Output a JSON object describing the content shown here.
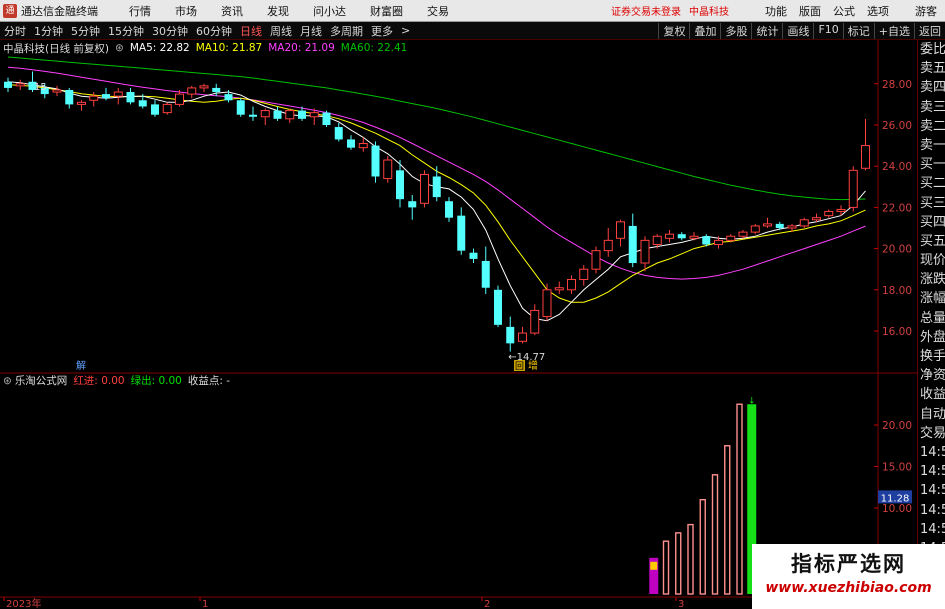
{
  "menubar": {
    "app_name": "通达信金融终端",
    "items": [
      "行情",
      "市场",
      "资讯",
      "发现",
      "问小达",
      "财富圈",
      "交易"
    ],
    "warning": "证券交易未登录",
    "brand": "中晶科技",
    "right_items": [
      "功能",
      "版面",
      "公式",
      "选项"
    ],
    "guest": "游客"
  },
  "toolbar": {
    "timeframes": [
      "分时",
      "1分钟",
      "5分钟",
      "15分钟",
      "30分钟",
      "60分钟",
      "日线",
      "周线",
      "月线",
      "多周期",
      "更多"
    ],
    "active": "日线",
    "right_buttons": [
      "复权",
      "叠加",
      "多股",
      "统计",
      "画线",
      "F10",
      "标记",
      "+自选",
      "返回"
    ]
  },
  "info": {
    "stock": "中晶科技(日线 前复权)",
    "ma5": "MA5: 22.82",
    "ma10": "MA10: 21.87",
    "ma20": "MA20: 21.09",
    "ma60": "MA60: 22.41"
  },
  "indicator": {
    "name": "乐淘公式网",
    "red_in": "红进: 0.00",
    "green_out": "绿出: 0.00",
    "profit": "收益点: -"
  },
  "right_panel": [
    "委比",
    "卖五",
    "卖四",
    "卖三",
    "卖二",
    "卖一",
    "买一",
    "买二",
    "买三",
    "买四",
    "买五",
    "现价",
    "涨跌",
    "涨幅",
    "总量",
    "外盘",
    "换手",
    "净资",
    "收益",
    "自动",
    "交易",
    "14:56",
    "14:56",
    "14:56",
    "14:56",
    "14:56",
    "14:56",
    "14:56",
    "14:56",
    "14:56"
  ],
  "markers": {
    "top_left": "15",
    "low_price": "14.77",
    "jie": "解",
    "hui": "回",
    "zeng": "增"
  },
  "axis": {
    "price_ticks": [
      "28.00",
      "26.00",
      "24.00",
      "22.00",
      "20.00",
      "18.00",
      "16.00"
    ],
    "ind_ticks": [
      "20.00",
      "15.00",
      "10.00"
    ],
    "current_ind": "11.28",
    "dates": [
      "2023年",
      "1",
      "2",
      "3"
    ]
  },
  "colors": {
    "up": "#ff4040",
    "down": "#54ffff",
    "ma5": "#ffffff",
    "ma10": "#ffff00",
    "ma20": "#ff40ff",
    "ma60": "#00c000",
    "grid": "#800000"
  },
  "watermark": {
    "title": "指标严选网",
    "url": "www.xuezhibiao.com"
  },
  "chart_data": {
    "type": "candlestick",
    "price_axis_ticks": [
      16,
      18,
      20,
      22,
      24,
      26,
      28
    ],
    "candles": [
      {
        "o": 28.1,
        "h": 28.3,
        "l": 27.6,
        "c": 27.8
      },
      {
        "o": 27.9,
        "h": 28.2,
        "l": 27.7,
        "c": 28.0
      },
      {
        "o": 28.1,
        "h": 28.6,
        "l": 27.6,
        "c": 27.7
      },
      {
        "o": 27.8,
        "h": 28.0,
        "l": 27.3,
        "c": 27.5
      },
      {
        "o": 27.6,
        "h": 27.9,
        "l": 27.4,
        "c": 27.7
      },
      {
        "o": 27.7,
        "h": 27.8,
        "l": 26.8,
        "c": 27.0
      },
      {
        "o": 27.0,
        "h": 27.2,
        "l": 26.7,
        "c": 27.1
      },
      {
        "o": 27.2,
        "h": 27.6,
        "l": 26.9,
        "c": 27.4
      },
      {
        "o": 27.5,
        "h": 27.8,
        "l": 27.2,
        "c": 27.3
      },
      {
        "o": 27.4,
        "h": 27.8,
        "l": 27.0,
        "c": 27.6
      },
      {
        "o": 27.6,
        "h": 27.8,
        "l": 27.0,
        "c": 27.1
      },
      {
        "o": 27.2,
        "h": 27.5,
        "l": 26.8,
        "c": 26.9
      },
      {
        "o": 27.0,
        "h": 27.2,
        "l": 26.4,
        "c": 26.5
      },
      {
        "o": 26.6,
        "h": 27.1,
        "l": 26.5,
        "c": 27.0
      },
      {
        "o": 27.0,
        "h": 27.7,
        "l": 26.9,
        "c": 27.5
      },
      {
        "o": 27.5,
        "h": 27.9,
        "l": 27.3,
        "c": 27.8
      },
      {
        "o": 27.8,
        "h": 28.0,
        "l": 27.6,
        "c": 27.9
      },
      {
        "o": 27.8,
        "h": 28.0,
        "l": 27.4,
        "c": 27.6
      },
      {
        "o": 27.5,
        "h": 27.7,
        "l": 27.1,
        "c": 27.2
      },
      {
        "o": 27.2,
        "h": 27.3,
        "l": 26.4,
        "c": 26.5
      },
      {
        "o": 26.5,
        "h": 26.9,
        "l": 26.2,
        "c": 26.4
      },
      {
        "o": 26.4,
        "h": 26.8,
        "l": 26.0,
        "c": 26.7
      },
      {
        "o": 26.7,
        "h": 26.9,
        "l": 26.2,
        "c": 26.3
      },
      {
        "o": 26.3,
        "h": 26.8,
        "l": 26.1,
        "c": 26.7
      },
      {
        "o": 26.7,
        "h": 26.9,
        "l": 26.2,
        "c": 26.3
      },
      {
        "o": 26.4,
        "h": 26.8,
        "l": 26.0,
        "c": 26.6
      },
      {
        "o": 26.6,
        "h": 26.7,
        "l": 25.9,
        "c": 26.0
      },
      {
        "o": 25.9,
        "h": 26.1,
        "l": 25.2,
        "c": 25.3
      },
      {
        "o": 25.3,
        "h": 25.5,
        "l": 24.8,
        "c": 24.9
      },
      {
        "o": 24.9,
        "h": 25.4,
        "l": 24.7,
        "c": 25.1
      },
      {
        "o": 25.0,
        "h": 25.2,
        "l": 23.2,
        "c": 23.5
      },
      {
        "o": 23.4,
        "h": 24.5,
        "l": 23.2,
        "c": 24.3
      },
      {
        "o": 23.8,
        "h": 24.3,
        "l": 22.0,
        "c": 22.4
      },
      {
        "o": 22.3,
        "h": 22.6,
        "l": 21.4,
        "c": 22.0
      },
      {
        "o": 22.2,
        "h": 23.8,
        "l": 22.0,
        "c": 23.6
      },
      {
        "o": 23.5,
        "h": 24.0,
        "l": 22.3,
        "c": 22.5
      },
      {
        "o": 22.3,
        "h": 22.5,
        "l": 21.3,
        "c": 21.5
      },
      {
        "o": 21.6,
        "h": 22.0,
        "l": 19.7,
        "c": 19.9
      },
      {
        "o": 19.8,
        "h": 20.0,
        "l": 19.3,
        "c": 19.5
      },
      {
        "o": 19.4,
        "h": 20.1,
        "l": 17.8,
        "c": 18.1
      },
      {
        "o": 18.0,
        "h": 18.2,
        "l": 16.2,
        "c": 16.3
      },
      {
        "o": 16.2,
        "h": 16.7,
        "l": 15.0,
        "c": 15.4
      },
      {
        "o": 15.5,
        "h": 16.2,
        "l": 15.4,
        "c": 15.9
      },
      {
        "o": 15.9,
        "h": 17.3,
        "l": 15.8,
        "c": 17.0
      },
      {
        "o": 16.7,
        "h": 18.3,
        "l": 16.5,
        "c": 18.0
      },
      {
        "o": 18.0,
        "h": 18.4,
        "l": 17.8,
        "c": 18.1
      },
      {
        "o": 18.0,
        "h": 18.7,
        "l": 17.8,
        "c": 18.5
      },
      {
        "o": 18.5,
        "h": 19.2,
        "l": 18.2,
        "c": 19.0
      },
      {
        "o": 19.0,
        "h": 20.1,
        "l": 18.8,
        "c": 19.9
      },
      {
        "o": 19.9,
        "h": 21.0,
        "l": 19.6,
        "c": 20.4
      },
      {
        "o": 20.5,
        "h": 21.4,
        "l": 20.1,
        "c": 21.3
      },
      {
        "o": 21.1,
        "h": 21.7,
        "l": 19.1,
        "c": 19.3
      },
      {
        "o": 19.3,
        "h": 20.6,
        "l": 18.9,
        "c": 20.4
      },
      {
        "o": 20.2,
        "h": 20.7,
        "l": 20.0,
        "c": 20.6
      },
      {
        "o": 20.5,
        "h": 20.9,
        "l": 20.3,
        "c": 20.7
      },
      {
        "o": 20.7,
        "h": 20.8,
        "l": 20.4,
        "c": 20.5
      },
      {
        "o": 20.5,
        "h": 20.8,
        "l": 20.4,
        "c": 20.6
      },
      {
        "o": 20.6,
        "h": 20.7,
        "l": 20.1,
        "c": 20.2
      },
      {
        "o": 20.2,
        "h": 20.6,
        "l": 20.0,
        "c": 20.4
      },
      {
        "o": 20.4,
        "h": 20.7,
        "l": 20.3,
        "c": 20.6
      },
      {
        "o": 20.6,
        "h": 20.9,
        "l": 20.5,
        "c": 20.8
      },
      {
        "o": 20.8,
        "h": 21.2,
        "l": 20.7,
        "c": 21.1
      },
      {
        "o": 21.1,
        "h": 21.5,
        "l": 21.0,
        "c": 21.2
      },
      {
        "o": 21.2,
        "h": 21.3,
        "l": 20.9,
        "c": 21.0
      },
      {
        "o": 21.0,
        "h": 21.2,
        "l": 20.8,
        "c": 21.1
      },
      {
        "o": 21.1,
        "h": 21.5,
        "l": 21.0,
        "c": 21.4
      },
      {
        "o": 21.4,
        "h": 21.7,
        "l": 21.3,
        "c": 21.5
      },
      {
        "o": 21.6,
        "h": 21.9,
        "l": 21.5,
        "c": 21.8
      },
      {
        "o": 21.8,
        "h": 22.1,
        "l": 21.6,
        "c": 21.9
      },
      {
        "o": 22.0,
        "h": 24.0,
        "l": 21.8,
        "c": 23.8
      },
      {
        "o": 23.9,
        "h": 26.3,
        "l": 23.8,
        "c": 25.0
      }
    ],
    "ma5": [
      28.1,
      28.05,
      27.95,
      27.85,
      27.75,
      27.55,
      27.4,
      27.35,
      27.3,
      27.35,
      27.4,
      27.4,
      27.25,
      27.1,
      27.1,
      27.2,
      27.4,
      27.55,
      27.6,
      27.45,
      27.15,
      26.9,
      26.7,
      26.5,
      26.45,
      26.45,
      26.4,
      26.15,
      25.75,
      25.4,
      24.95,
      24.6,
      24.1,
      23.5,
      23.15,
      23.0,
      22.9,
      22.5,
      21.9,
      20.9,
      19.5,
      18.2,
      17.1,
      16.6,
      16.5,
      16.8,
      17.4,
      18.0,
      18.5,
      19.0,
      19.6,
      19.8,
      20.0,
      20.1,
      20.2,
      20.3,
      20.45,
      20.6,
      20.5,
      20.45,
      20.5,
      20.6,
      20.8,
      20.95,
      21.05,
      21.2,
      21.3,
      21.45,
      21.6,
      22.1,
      22.8
    ],
    "ma10": [
      27.95,
      27.92,
      27.88,
      27.8,
      27.72,
      27.62,
      27.52,
      27.45,
      27.4,
      27.38,
      27.38,
      27.4,
      27.37,
      27.3,
      27.22,
      27.15,
      27.1,
      27.15,
      27.25,
      27.3,
      27.2,
      27.05,
      26.9,
      26.75,
      26.65,
      26.55,
      26.45,
      26.3,
      26.1,
      25.85,
      25.6,
      25.3,
      25.0,
      24.55,
      24.15,
      23.75,
      23.45,
      23.1,
      22.7,
      22.1,
      21.3,
      20.4,
      19.6,
      18.8,
      18.0,
      17.6,
      17.4,
      17.4,
      17.6,
      17.9,
      18.3,
      18.7,
      19.0,
      19.3,
      19.5,
      19.75,
      20.0,
      20.15,
      20.3,
      20.35,
      20.45,
      20.55,
      20.65,
      20.75,
      20.85,
      20.95,
      21.1,
      21.2,
      21.35,
      21.6,
      21.87
    ],
    "ma20": [
      28.8,
      28.75,
      28.68,
      28.6,
      28.52,
      28.42,
      28.32,
      28.22,
      28.12,
      28.02,
      27.92,
      27.83,
      27.75,
      27.67,
      27.6,
      27.53,
      27.47,
      27.42,
      27.37,
      27.3,
      27.22,
      27.12,
      27.02,
      26.92,
      26.82,
      26.72,
      26.6,
      26.46,
      26.3,
      26.12,
      25.9,
      25.66,
      25.4,
      25.1,
      24.8,
      24.5,
      24.2,
      23.9,
      23.6,
      23.25,
      22.85,
      22.4,
      21.95,
      21.5,
      21.05,
      20.65,
      20.3,
      19.95,
      19.6,
      19.3,
      19.05,
      18.85,
      18.7,
      18.6,
      18.55,
      18.52,
      18.55,
      18.6,
      18.7,
      18.85,
      19.0,
      19.2,
      19.4,
      19.6,
      19.8,
      20.0,
      20.2,
      20.4,
      20.6,
      20.85,
      21.09
    ],
    "ma60": [
      29.3,
      29.25,
      29.2,
      29.15,
      29.1,
      29.05,
      29.0,
      28.95,
      28.9,
      28.85,
      28.8,
      28.75,
      28.7,
      28.65,
      28.6,
      28.55,
      28.5,
      28.45,
      28.4,
      28.35,
      28.28,
      28.2,
      28.12,
      28.04,
      27.96,
      27.88,
      27.8,
      27.7,
      27.6,
      27.5,
      27.4,
      27.28,
      27.16,
      27.04,
      26.92,
      26.8,
      26.66,
      26.52,
      26.38,
      26.22,
      26.06,
      25.9,
      25.74,
      25.58,
      25.42,
      25.26,
      25.1,
      24.94,
      24.78,
      24.62,
      24.46,
      24.3,
      24.14,
      23.98,
      23.82,
      23.66,
      23.5,
      23.36,
      23.22,
      23.08,
      22.96,
      22.84,
      22.74,
      22.64,
      22.56,
      22.5,
      22.44,
      22.4,
      22.38,
      22.39,
      22.41
    ],
    "indicator": {
      "ticks": [
        10,
        15,
        20
      ],
      "current": 11.28,
      "bars": [
        {
          "idx": 53,
          "value": 4.0,
          "color": "purple"
        },
        {
          "idx": 54,
          "value": 6.0,
          "color": "red"
        },
        {
          "idx": 55,
          "value": 7.0,
          "color": "red"
        },
        {
          "idx": 56,
          "value": 8.0,
          "color": "red"
        },
        {
          "idx": 57,
          "value": 11.0,
          "color": "red"
        },
        {
          "idx": 58,
          "value": 14.0,
          "color": "red"
        },
        {
          "idx": 59,
          "value": 17.5,
          "color": "red"
        },
        {
          "idx": 60,
          "value": 22.5,
          "color": "red"
        },
        {
          "idx": 61,
          "value": 22.5,
          "color": "green"
        }
      ]
    }
  }
}
